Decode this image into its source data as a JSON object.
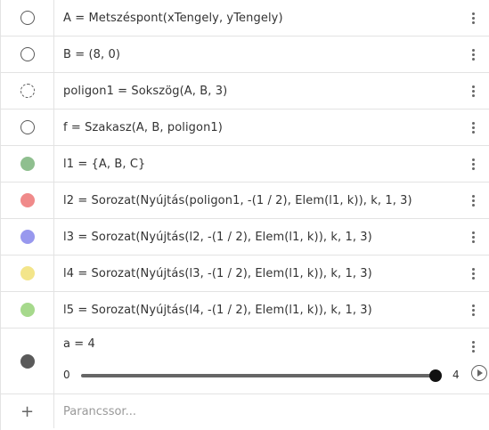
{
  "algebra": {
    "rows": [
      {
        "expr": "A = Metszéspont(xTengely, yTengely)",
        "marble": "hidden",
        "color": ""
      },
      {
        "expr": "B = (8, 0)",
        "marble": "hidden",
        "color": ""
      },
      {
        "expr": "poligon1 = Sokszög(A, B, 3)",
        "marble": "hidden-dashed",
        "color": ""
      },
      {
        "expr": "f = Szakasz(A, B, poligon1)",
        "marble": "hidden",
        "color": ""
      },
      {
        "expr": "l1 = {A, B, C}",
        "marble": "filled",
        "color": "#8fbf8f"
      },
      {
        "expr": "l2 = Sorozat(Nyújtás(poligon1, -(1 / 2), Elem(l1, k)), k, 1, 3)",
        "marble": "filled",
        "color": "#f08a8a"
      },
      {
        "expr": "l3 = Sorozat(Nyújtás(l2, -(1 / 2), Elem(l1, k)), k, 1, 3)",
        "marble": "filled",
        "color": "#9898ee"
      },
      {
        "expr": "l4 = Sorozat(Nyújtás(l3, -(1 / 2), Elem(l1, k)), k, 1, 3)",
        "marble": "filled",
        "color": "#f3e58a"
      },
      {
        "expr": "l5 = Sorozat(Nyújtás(l4, -(1 / 2), Elem(l1, k)), k, 1, 3)",
        "marble": "filled",
        "color": "#a6d98c"
      }
    ],
    "slider": {
      "expr": "a = 4",
      "min": "0",
      "max": "4",
      "value_fraction": 1.0,
      "color": "#5a5a5a"
    },
    "input": {
      "plus": "+",
      "placeholder": "Parancssor..."
    }
  }
}
